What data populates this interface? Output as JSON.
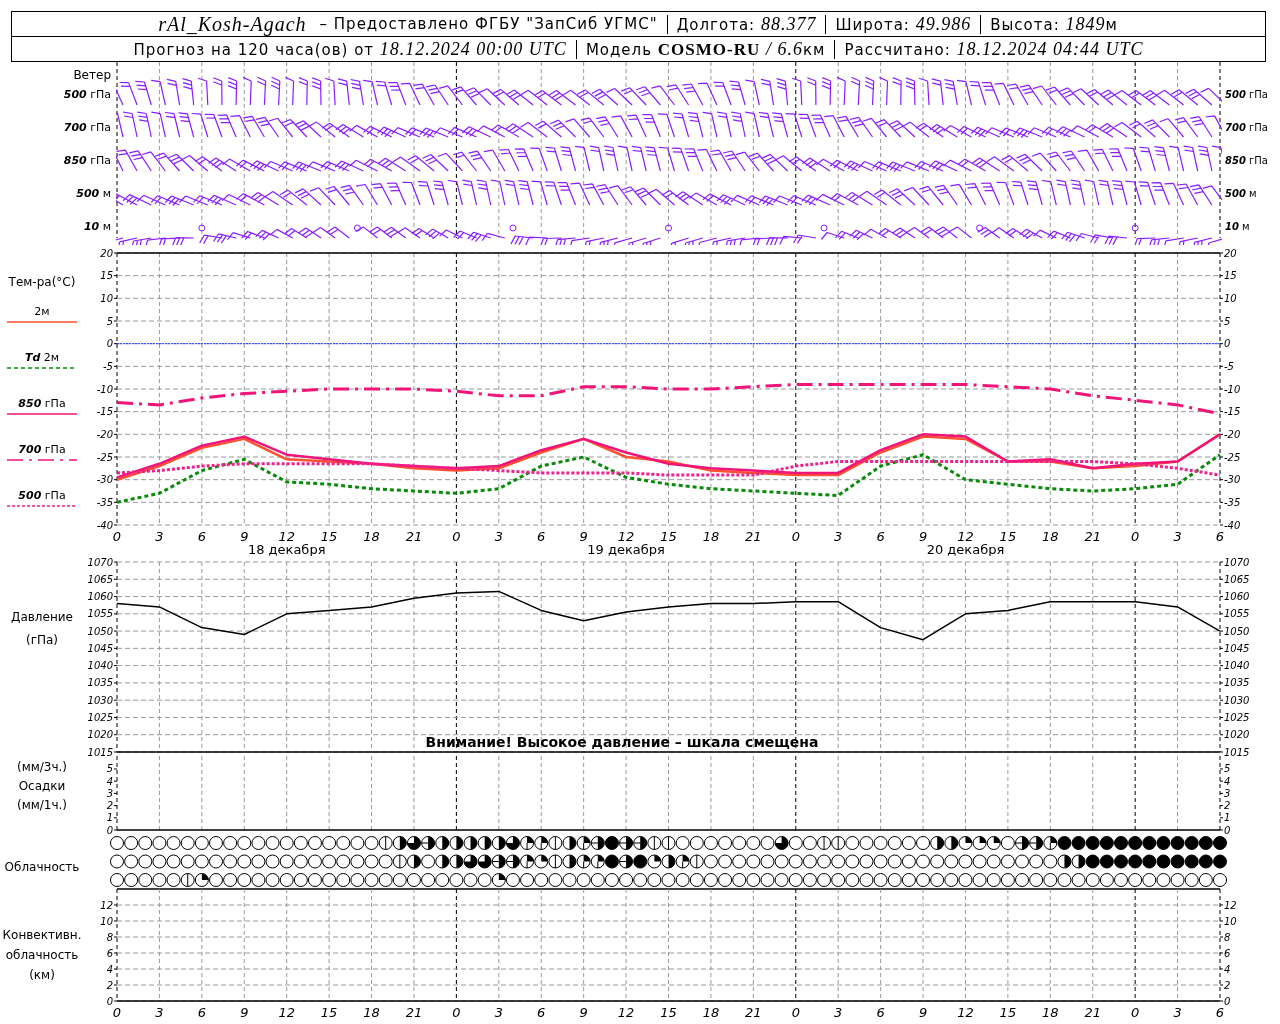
{
  "header": {
    "station": "rAl_Kosh-Agach",
    "provider": "– Предоставлено ФГБУ \"ЗапСиб УГМС\"",
    "fields": [
      {
        "label": "Долгота:",
        "value": "88.377"
      },
      {
        "label": "Широта:",
        "value": "49.986"
      },
      {
        "label": "Высота:",
        "value": "1849",
        "unit": "м"
      }
    ],
    "forecast": {
      "label": "Прогноз на 120 часа(ов) от",
      "value": "18.12.2024 00:00 UTC"
    },
    "model": {
      "label": "Модель",
      "name": "COSMO-RU",
      "resolution": "/ 6.6",
      "unit": "км"
    },
    "computed": {
      "label": "Рассчитано:",
      "value": "18.12.2024 04:44 UTC"
    }
  },
  "wind": {
    "title": "Ветер",
    "levels": [
      {
        "left_label": "*500* гПа",
        "right_label": "*500* гПа"
      },
      {
        "left_label": "*700* гПа",
        "right_label": "*700* гПа"
      },
      {
        "left_label": "*850* гПа",
        "right_label": "*850* гПа"
      },
      {
        "left_label": "*500* м",
        "right_label": "*500* м"
      },
      {
        "left_label": "*10* м",
        "right_label": "*10* м"
      }
    ]
  },
  "temperature": {
    "chart_data": {
      "type": "line",
      "title": "Тем-ра(°C)",
      "categories": [
        "0",
        "3",
        "6",
        "9",
        "12",
        "15",
        "18",
        "21",
        "0",
        "3",
        "6",
        "9",
        "12",
        "15",
        "18",
        "21",
        "0",
        "3",
        "6",
        "9",
        "12",
        "15",
        "18",
        "21",
        "0",
        "3",
        "6"
      ],
      "ylim": [
        -40,
        20
      ],
      "yticks": [
        20,
        15,
        10,
        5,
        0,
        -5,
        -10,
        -15,
        -20,
        -25,
        -30,
        -35,
        -40
      ],
      "grid": true,
      "ref_lines": [
        {
          "value": 0,
          "axis": "y",
          "color": "#2040ff"
        }
      ],
      "series": [
        {
          "name": "2м",
          "color": "#ff5030",
          "line_style": "solid",
          "values": [
            -30,
            -27,
            -23,
            -21,
            -25.5,
            -26,
            -26.5,
            -27.5,
            -28,
            -27.5,
            -24,
            -21,
            -25,
            -26,
            -28,
            -28.5,
            -29,
            -29,
            -24,
            -20.5,
            -21,
            -26,
            -26,
            -27.5,
            -27,
            -26,
            -20
          ]
        },
        {
          "name": "*Td* 2м",
          "color": "#0a8a0a",
          "line_style": "dashed",
          "values": [
            -35,
            -33,
            -28,
            -25.5,
            -30.5,
            -31,
            -32,
            -32.5,
            -33,
            -32,
            -27,
            -25,
            -29.5,
            -31,
            -32,
            -32.5,
            -33,
            -33.5,
            -27,
            -24.5,
            -30,
            -31,
            -32,
            -32.5,
            -32,
            -31,
            -24.5
          ]
        },
        {
          "name": "*850* гПа",
          "color": "#f01478",
          "line_style": "solid",
          "values": [
            -29.5,
            -26.5,
            -22.5,
            -20.5,
            -24.5,
            -25.5,
            -26.5,
            -27,
            -27.5,
            -27,
            -23.5,
            -21,
            -24,
            -26.5,
            -27.5,
            -28,
            -28.5,
            -28.5,
            -23.5,
            -20,
            -20.5,
            -26,
            -25.5,
            -27.5,
            -26.5,
            -26,
            -20
          ]
        },
        {
          "name": "*700* гПа",
          "color": "#f01478",
          "line_style": "dashdot",
          "values": [
            -13,
            -13.5,
            -12,
            -11,
            -10.5,
            -10,
            -10,
            -10,
            -10.5,
            -11.5,
            -11.5,
            -9.5,
            -9.5,
            -10,
            -10,
            -9.5,
            -9,
            -9,
            -9,
            -9,
            -9,
            -9.5,
            -10,
            -11.5,
            -12.5,
            -13.5,
            -15.5
          ]
        },
        {
          "name": "*500* гПа",
          "color": "#f0208c",
          "line_style": "dotted",
          "values": [
            -28.5,
            -28,
            -27,
            -26.5,
            -26.5,
            -26.5,
            -26.5,
            -27,
            -27.5,
            -28,
            -28.5,
            -28.5,
            -28.5,
            -29,
            -29,
            -29,
            -27,
            -26,
            -26,
            -26,
            -26,
            -26,
            -26,
            -26,
            -26.5,
            -27.5,
            -29
          ]
        }
      ]
    },
    "right_ticks": [
      "20",
      "15",
      "10",
      "5",
      "0",
      "-5",
      "-10",
      "-15",
      "-20",
      "-25",
      "-30",
      "-35",
      "-40"
    ],
    "dates": [
      "18 декабря",
      "19 декабря",
      "20 декабря"
    ]
  },
  "pressure": {
    "warning": "Внимание! Высокое давление – шкала смещена",
    "chart_data": {
      "type": "line",
      "title": "Давление",
      "ylabel": "(гПа)",
      "categories": [
        null,
        null,
        null,
        null,
        null,
        null,
        null,
        null,
        null,
        null,
        null,
        null,
        null,
        null,
        null,
        null,
        null,
        null,
        null,
        null,
        null,
        null,
        null,
        null,
        null,
        null,
        null
      ],
      "ylim": [
        1015,
        1070
      ],
      "yticks": [
        1070,
        1065,
        1060,
        1055,
        1050,
        1045,
        1040,
        1035,
        1030,
        1025,
        1020,
        1015
      ],
      "grid": true,
      "series": [
        {
          "color": "#000000",
          "values": [
            1058,
            1057,
            1051,
            1049,
            1055,
            1056,
            1057,
            1059.5,
            1061,
            1061.5,
            1056,
            1053,
            1055.5,
            1057,
            1058,
            1058,
            1058.5,
            1058.5,
            1051,
            1047.5,
            1055,
            1056,
            1058.5,
            1058.5,
            1058.5,
            1057,
            1050
          ]
        }
      ]
    },
    "right_ticks": [
      "1070",
      "1065",
      "1060",
      "1055",
      "1050",
      "1045",
      "1040",
      "1035",
      "1030",
      "1025",
      "1020",
      "1015"
    ]
  },
  "precipitation": {
    "labels": [
      "(мм/3ч.)",
      "Осадки",
      "(мм/1ч.)"
    ],
    "chart_data": {
      "type": "bar",
      "categories": [
        null,
        null,
        null,
        null,
        null,
        null,
        null,
        null,
        null,
        null,
        null,
        null,
        null,
        null,
        null,
        null,
        null,
        null,
        null,
        null,
        null,
        null,
        null,
        null,
        null,
        null,
        null
      ],
      "values": [
        null,
        null,
        null,
        null,
        null,
        null,
        null,
        null,
        null,
        null,
        null,
        null,
        null,
        null,
        null,
        null,
        null,
        null,
        null,
        null,
        null,
        null,
        null,
        null,
        null,
        null,
        null
      ],
      "ylim": [
        0,
        5.9
      ],
      "yticks": [
        5,
        4,
        3,
        2,
        1,
        0
      ],
      "grid": true
    },
    "right_ticks": [
      "5",
      "4",
      "3",
      "2",
      "1",
      "0"
    ]
  },
  "clouds": {
    "label": "Облачность",
    "rows": [
      {
        "cells": [
          {
            "kind": "okta0"
          },
          {
            "kind": "okta0"
          },
          {
            "kind": "okta0"
          },
          {
            "kind": "okta0"
          },
          {
            "kind": "okta0"
          },
          {
            "kind": "okta0"
          },
          {
            "kind": "okta0"
          },
          {
            "kind": "okta0"
          },
          {
            "kind": "okta0"
          },
          {
            "kind": "okta0"
          },
          {
            "kind": "okta0"
          },
          {
            "kind": "okta0"
          },
          {
            "kind": "okta0"
          },
          {
            "kind": "okta0"
          },
          {
            "kind": "okta0"
          },
          {
            "kind": "okta0"
          },
          {
            "kind": "okta0"
          },
          {
            "kind": "okta0"
          },
          {
            "kind": "okta0"
          },
          {
            "kind": "okta1"
          },
          {
            "kind": "okta4"
          },
          {
            "kind": "okta6"
          },
          {
            "kind": "okta5"
          },
          {
            "kind": "okta4"
          },
          {
            "kind": "okta4"
          },
          {
            "kind": "okta4"
          },
          {
            "kind": "okta4"
          },
          {
            "kind": "okta4"
          },
          {
            "kind": "okta6"
          },
          {
            "kind": "okta3"
          },
          {
            "kind": "okta3"
          },
          {
            "kind": "okta1"
          },
          {
            "kind": "okta4"
          },
          {
            "kind": "okta3"
          },
          {
            "kind": "okta5"
          },
          {
            "kind": "okta8"
          },
          {
            "kind": "okta5"
          },
          {
            "kind": "okta5"
          },
          {
            "kind": "okta1"
          },
          {
            "kind": "okta1"
          },
          {
            "kind": "okta0"
          },
          {
            "kind": "okta0"
          },
          {
            "kind": "okta0"
          },
          {
            "kind": "okta0"
          },
          {
            "kind": "okta0"
          },
          {
            "kind": "okta0"
          },
          {
            "kind": "okta0"
          },
          {
            "kind": "okta6"
          },
          {
            "kind": "okta0"
          },
          {
            "kind": "okta0"
          },
          {
            "kind": "okta1"
          },
          {
            "kind": "okta1"
          },
          {
            "kind": "okta0"
          },
          {
            "kind": "okta0"
          },
          {
            "kind": "okta0"
          },
          {
            "kind": "okta0"
          },
          {
            "kind": "okta0"
          },
          {
            "kind": "okta0"
          },
          {
            "kind": "okta4"
          },
          {
            "kind": "okta4"
          },
          {
            "kind": "okta2"
          },
          {
            "kind": "okta2"
          },
          {
            "kind": "okta2"
          },
          {
            "kind": "okta0"
          },
          {
            "kind": "okta5"
          },
          {
            "kind": "okta5"
          },
          {
            "kind": "okta3"
          },
          {
            "kind": "okta8"
          },
          {
            "kind": "okta8"
          },
          {
            "kind": "okta8"
          },
          {
            "kind": "okta8"
          },
          {
            "kind": "okta8"
          },
          {
            "kind": "okta8"
          },
          {
            "kind": "okta8"
          },
          {
            "kind": "okta8"
          },
          {
            "kind": "okta8"
          },
          {
            "kind": "okta8"
          },
          {
            "kind": "okta8"
          },
          {
            "kind": "okta8"
          }
        ]
      },
      {
        "cells": [
          {
            "kind": "okta0"
          },
          {
            "kind": "okta0"
          },
          {
            "kind": "okta0"
          },
          {
            "kind": "okta0"
          },
          {
            "kind": "okta0"
          },
          {
            "kind": "okta0"
          },
          {
            "kind": "okta0"
          },
          {
            "kind": "okta0"
          },
          {
            "kind": "okta0"
          },
          {
            "kind": "okta0"
          },
          {
            "kind": "okta0"
          },
          {
            "kind": "okta0"
          },
          {
            "kind": "okta0"
          },
          {
            "kind": "okta0"
          },
          {
            "kind": "okta0"
          },
          {
            "kind": "okta0"
          },
          {
            "kind": "okta0"
          },
          {
            "kind": "okta0"
          },
          {
            "kind": "okta0"
          },
          {
            "kind": "okta0"
          },
          {
            "kind": "okta1"
          },
          {
            "kind": "okta4"
          },
          {
            "kind": "okta0"
          },
          {
            "kind": "okta4"
          },
          {
            "kind": "okta4"
          },
          {
            "kind": "okta6"
          },
          {
            "kind": "okta6"
          },
          {
            "kind": "okta5"
          },
          {
            "kind": "okta5"
          },
          {
            "kind": "okta3"
          },
          {
            "kind": "okta2"
          },
          {
            "kind": "okta1"
          },
          {
            "kind": "okta4"
          },
          {
            "kind": "okta3"
          },
          {
            "kind": "okta3"
          },
          {
            "kind": "okta8"
          },
          {
            "kind": "okta5"
          },
          {
            "kind": "okta8"
          },
          {
            "kind": "okta2"
          },
          {
            "kind": "okta4"
          },
          {
            "kind": "okta3"
          },
          {
            "kind": "okta1"
          },
          {
            "kind": "okta0"
          },
          {
            "kind": "okta0"
          },
          {
            "kind": "okta0"
          },
          {
            "kind": "okta0"
          },
          {
            "kind": "okta0"
          },
          {
            "kind": "okta0"
          },
          {
            "kind": "okta0"
          },
          {
            "kind": "okta0"
          },
          {
            "kind": "okta0"
          },
          {
            "kind": "okta0"
          },
          {
            "kind": "okta0"
          },
          {
            "kind": "okta0"
          },
          {
            "kind": "okta0"
          },
          {
            "kind": "okta0"
          },
          {
            "kind": "okta0"
          },
          {
            "kind": "okta0"
          },
          {
            "kind": "okta0"
          },
          {
            "kind": "okta0"
          },
          {
            "kind": "okta0"
          },
          {
            "kind": "okta0"
          },
          {
            "kind": "okta0"
          },
          {
            "kind": "okta0"
          },
          {
            "kind": "okta0"
          },
          {
            "kind": "okta0"
          },
          {
            "kind": "okta0"
          },
          {
            "kind": "okta4"
          },
          {
            "kind": "okta4"
          },
          {
            "kind": "okta8"
          },
          {
            "kind": "okta8"
          },
          {
            "kind": "okta8"
          },
          {
            "kind": "okta8"
          },
          {
            "kind": "okta8"
          },
          {
            "kind": "okta8"
          },
          {
            "kind": "okta8"
          },
          {
            "kind": "okta8"
          },
          {
            "kind": "okta8"
          },
          {
            "kind": "okta8"
          }
        ]
      },
      {
        "cells": [
          {
            "kind": "okta0"
          },
          {
            "kind": "okta0"
          },
          {
            "kind": "okta0"
          },
          {
            "kind": "okta0"
          },
          {
            "kind": "okta0"
          },
          {
            "kind": "okta1"
          },
          {
            "kind": "okta2"
          },
          {
            "kind": "okta0"
          },
          {
            "kind": "okta0"
          },
          {
            "kind": "okta0"
          },
          {
            "kind": "okta0"
          },
          {
            "kind": "okta0"
          },
          {
            "kind": "okta0"
          },
          {
            "kind": "okta0"
          },
          {
            "kind": "okta0"
          },
          {
            "kind": "okta0"
          },
          {
            "kind": "okta0"
          },
          {
            "kind": "okta0"
          },
          {
            "kind": "okta0"
          },
          {
            "kind": "okta0"
          },
          {
            "kind": "okta0"
          },
          {
            "kind": "okta0"
          },
          {
            "kind": "okta0"
          },
          {
            "kind": "okta0"
          },
          {
            "kind": "okta0"
          },
          {
            "kind": "okta0"
          },
          {
            "kind": "okta0"
          },
          {
            "kind": "okta2"
          },
          {
            "kind": "okta0"
          },
          {
            "kind": "okta0"
          },
          {
            "kind": "okta0"
          },
          {
            "kind": "okta0"
          },
          {
            "kind": "okta0"
          },
          {
            "kind": "okta0"
          },
          {
            "kind": "okta0"
          },
          {
            "kind": "okta0"
          },
          {
            "kind": "okta0"
          },
          {
            "kind": "okta0"
          },
          {
            "kind": "okta0"
          },
          {
            "kind": "okta0"
          },
          {
            "kind": "okta0"
          },
          {
            "kind": "okta0"
          },
          {
            "kind": "okta0"
          },
          {
            "kind": "okta0"
          },
          {
            "kind": "okta0"
          },
          {
            "kind": "okta0"
          },
          {
            "kind": "okta0"
          },
          {
            "kind": "okta0"
          },
          {
            "kind": "okta0"
          },
          {
            "kind": "okta0"
          },
          {
            "kind": "okta0"
          },
          {
            "kind": "okta0"
          },
          {
            "kind": "okta0"
          },
          {
            "kind": "okta0"
          },
          {
            "kind": "okta0"
          },
          {
            "kind": "okta0"
          },
          {
            "kind": "okta0"
          },
          {
            "kind": "okta0"
          },
          {
            "kind": "okta0"
          },
          {
            "kind": "okta0"
          },
          {
            "kind": "okta0"
          },
          {
            "kind": "okta0"
          },
          {
            "kind": "okta0"
          },
          {
            "kind": "okta0"
          },
          {
            "kind": "okta0"
          },
          {
            "kind": "okta0"
          },
          {
            "kind": "okta0"
          },
          {
            "kind": "okta0"
          },
          {
            "kind": "okta0"
          },
          {
            "kind": "okta0"
          },
          {
            "kind": "okta0"
          },
          {
            "kind": "okta0"
          },
          {
            "kind": "okta0"
          },
          {
            "kind": "okta0"
          },
          {
            "kind": "okta0"
          },
          {
            "kind": "okta0"
          },
          {
            "kind": "okta0"
          },
          {
            "kind": "okta0"
          },
          {
            "kind": "okta0"
          }
        ]
      }
    ]
  },
  "convective": {
    "labels": [
      "Конвективн.",
      "облачность",
      "(км)"
    ],
    "chart_data": {
      "type": "bar",
      "values": [
        null,
        null,
        null,
        null,
        null,
        null,
        null,
        null,
        null,
        null,
        null,
        null,
        null,
        null,
        null,
        null,
        null,
        null,
        null,
        null,
        null,
        null,
        null,
        null,
        null,
        null,
        null
      ],
      "categories": [
        "0",
        "3",
        "6",
        "9",
        "12",
        "15",
        "18",
        "21",
        "0",
        "3",
        "6",
        "9",
        "12",
        "15",
        "18",
        "21",
        "0",
        "3",
        "6",
        "9",
        "12",
        "15",
        "18",
        "21",
        "0",
        "3",
        "6"
      ],
      "ylim": [
        0,
        14
      ],
      "yticks": [
        12,
        10,
        8,
        6,
        4,
        2,
        0
      ],
      "grid": true
    },
    "right_ticks": [
      "12",
      "10",
      "8",
      "6",
      "4",
      "2",
      "0"
    ]
  }
}
